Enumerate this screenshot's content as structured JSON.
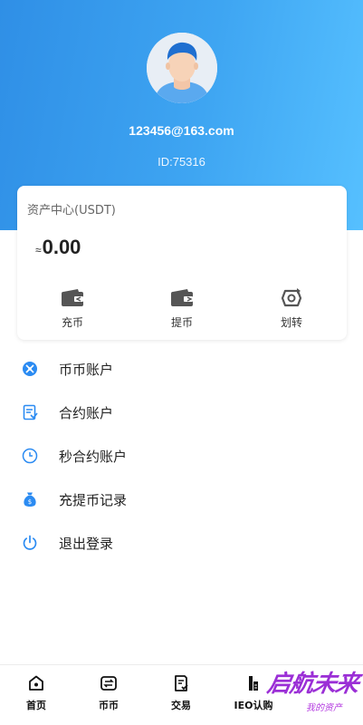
{
  "profile": {
    "email": "123456@163.com",
    "id_text": "ID:75316"
  },
  "asset_card": {
    "title": "资产中心(USDT)",
    "approx": "≈",
    "balance": "0.00",
    "actions": [
      {
        "label": "充币",
        "icon": "wallet-deposit-icon"
      },
      {
        "label": "提币",
        "icon": "wallet-withdraw-icon"
      },
      {
        "label": "划转",
        "icon": "transfer-icon"
      }
    ]
  },
  "menu": [
    {
      "label": "币币账户",
      "icon": "coin-account-icon"
    },
    {
      "label": "合约账户",
      "icon": "contract-doc-icon"
    },
    {
      "label": "秒合约账户",
      "icon": "clock-icon"
    },
    {
      "label": "充提币记录",
      "icon": "money-bag-icon"
    },
    {
      "label": "退出登录",
      "icon": "power-icon"
    }
  ],
  "tabbar": [
    {
      "label": "首页",
      "icon": "home-icon"
    },
    {
      "label": "币币",
      "icon": "exchange-icon"
    },
    {
      "label": "交易",
      "icon": "trade-icon"
    },
    {
      "label": "IEO认购",
      "icon": "ieo-icon"
    }
  ],
  "watermark": {
    "main": "启航未来",
    "sub": "我的资产"
  },
  "colors": {
    "header_start": "#2f8fe6",
    "header_end": "#56c0ff",
    "menu_icon": "#2b8bf2"
  }
}
